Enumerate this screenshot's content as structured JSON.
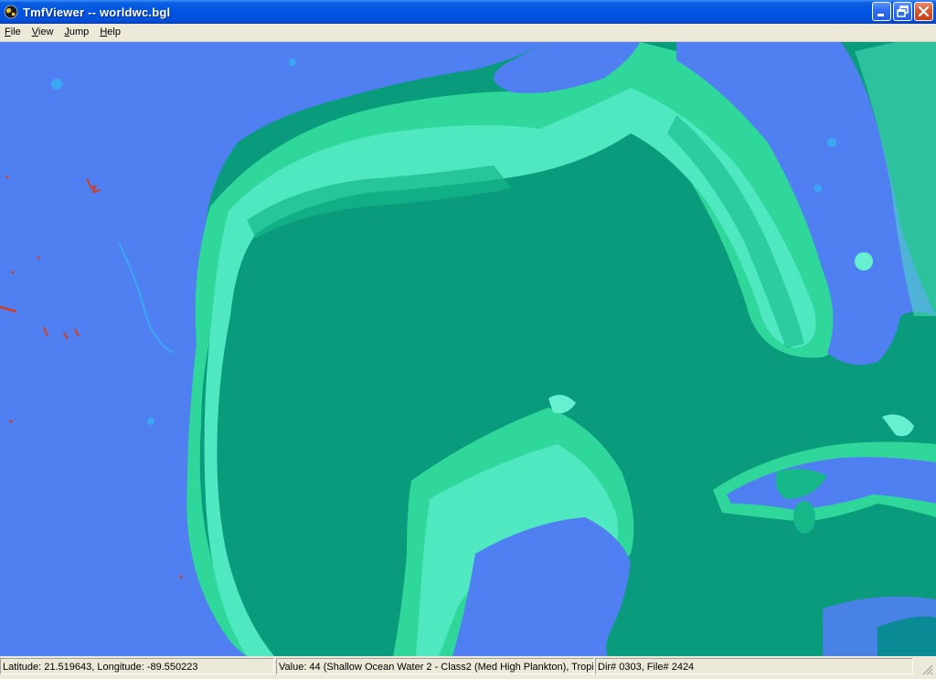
{
  "window": {
    "title": "TmfViewer -- worldwc.bgl",
    "controls": {
      "minimize": "minimize-icon",
      "restore": "restore-icon",
      "close": "close-icon"
    }
  },
  "menu": {
    "items": [
      {
        "first": "F",
        "rest": "ile"
      },
      {
        "first": "V",
        "rest": "iew"
      },
      {
        "first": "J",
        "rest": "ump"
      },
      {
        "first": "H",
        "rest": "elp"
      }
    ]
  },
  "map": {
    "colors": {
      "land": "#4f7ff0",
      "deep_water": "#0a9a7c",
      "shallow_1": "#16b88a",
      "shallow_2": "#2fd89a",
      "shallow_3": "#4fe8c0",
      "shallow_4": "#66f0d0",
      "lake": "#3aa8f0",
      "red_feature": "#d04020"
    }
  },
  "status": {
    "coords": "Latitude: 21.519643, Longitude: -89.550223",
    "value": "Value: 44 (Shallow Ocean Water 2 - Class2 (Med High Plankton), Tropica",
    "file": "Dir# 0303, File# 2424"
  }
}
